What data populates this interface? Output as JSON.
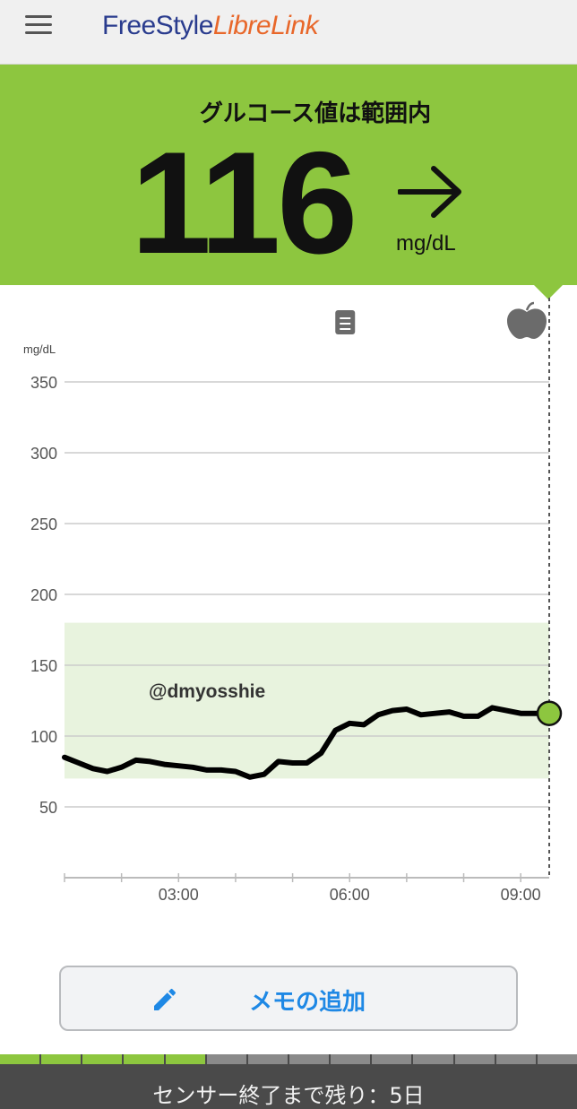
{
  "header": {
    "menu_icon": "hamburger-menu-icon",
    "logo_part1": "FreeStyle",
    "logo_part2": "LibreLink"
  },
  "reading": {
    "status": "グルコース値は範囲内",
    "value": "116",
    "unit": "mg/dL",
    "trend_icon": "arrow-right-icon",
    "status_color": "#8dc63f"
  },
  "chart_data": {
    "type": "line",
    "ylabel": "mg/dL",
    "ylim": [
      0,
      350
    ],
    "yticks": [
      50,
      100,
      150,
      200,
      250,
      300,
      350
    ],
    "target_range": [
      70,
      180
    ],
    "xlim": [
      "01:00",
      "09:30"
    ],
    "x_tick_labels": [
      "03:00",
      "06:00",
      "09:00"
    ],
    "annotation": "@dmyosshie",
    "icons": {
      "note_time": "06:00",
      "note_icon": "note-icon",
      "food_time": "09:30",
      "food_icon": "apple-icon"
    },
    "series": [
      {
        "x": [
          "01:00",
          "01:15",
          "01:30",
          "01:45",
          "02:00",
          "02:15",
          "02:30",
          "02:45",
          "03:00",
          "03:15",
          "03:30",
          "03:45",
          "04:00",
          "04:15",
          "04:30",
          "04:45",
          "05:00",
          "05:15",
          "05:30",
          "05:45",
          "06:00",
          "06:15",
          "06:30",
          "06:45",
          "07:00",
          "07:15",
          "07:30",
          "07:45",
          "08:00",
          "08:15",
          "08:30",
          "08:45",
          "09:00",
          "09:15",
          "09:30"
        ],
        "values": [
          85,
          81,
          77,
          75,
          78,
          83,
          82,
          80,
          79,
          78,
          76,
          76,
          75,
          71,
          73,
          82,
          81,
          81,
          88,
          104,
          109,
          108,
          115,
          118,
          119,
          115,
          116,
          117,
          114,
          114,
          120,
          118,
          116,
          116,
          116
        ]
      }
    ],
    "current_point": {
      "x": "09:30",
      "y": 116
    },
    "colors": {
      "line": "#000000",
      "target_band": "#e8f3de",
      "grid": "#cccccc",
      "current_point": "#8dc63f"
    }
  },
  "memo_button": {
    "label": "メモの追加",
    "icon": "pencil-icon"
  },
  "sensor": {
    "text": "センサー終了まで残り：5日",
    "segments_total": 14,
    "segments_used": 5,
    "used_color": "#8dc63f",
    "remaining_color": "#8a8a8a"
  }
}
